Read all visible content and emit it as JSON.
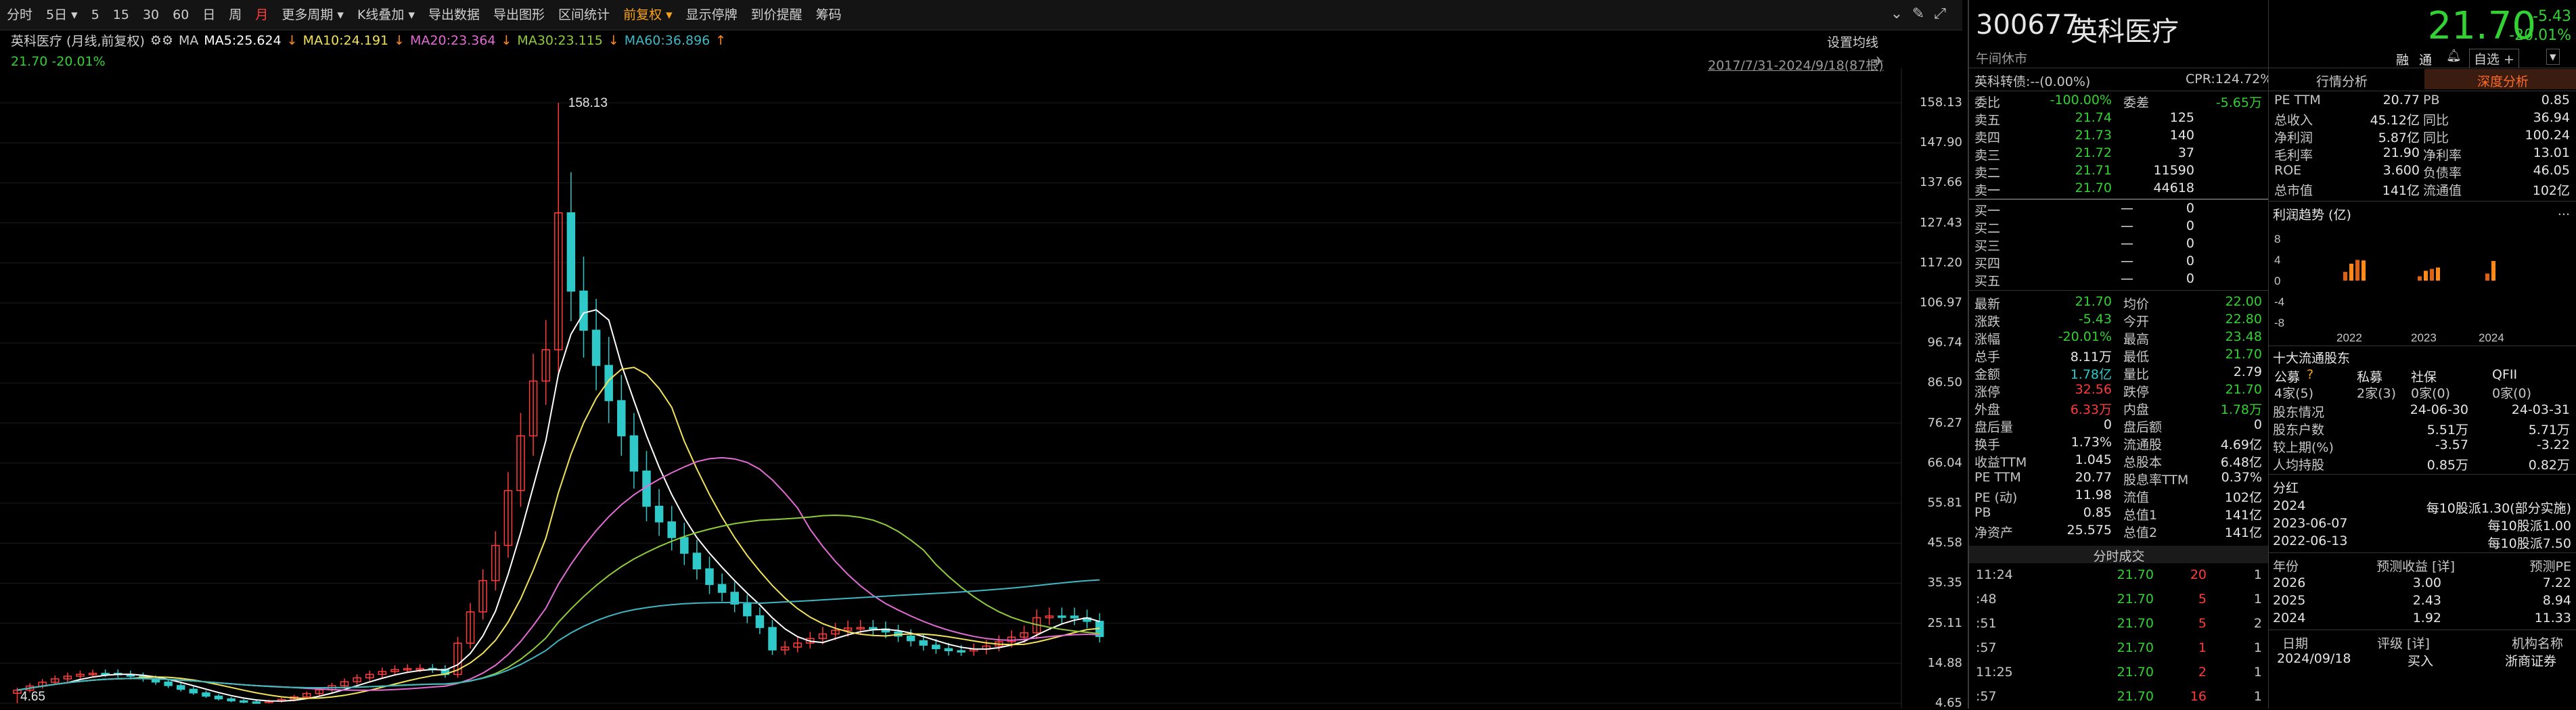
{
  "toolbar": {
    "items": [
      "分时",
      "5日",
      "5",
      "15",
      "30",
      "60",
      "日",
      "周",
      "月",
      "更多周期",
      "K线叠加",
      "导出数据",
      "导出图形",
      "区间统计",
      "前复权",
      "显示停牌",
      "到价提醒",
      "筹码"
    ],
    "active_index": 8
  },
  "chart": {
    "title": "英科医疗 (月线,前复权)",
    "ma_label": "MA",
    "ma5": "MA5:25.624",
    "ma10": "MA10:24.191",
    "ma20": "MA20:23.364",
    "ma30": "MA30:23.115",
    "ma60": "MA60:36.896",
    "ma_arrow_up": "↑",
    "ma_arrow_down": "↓",
    "price_line": "21.70  -20.01%",
    "settings": "设置均线",
    "range": "2017/7/31-2024/9/18(87根)",
    "peak_label": "158.13",
    "low_label": "4.65",
    "y_ticks": [
      "158.13",
      "147.90",
      "137.66",
      "127.43",
      "117.20",
      "106.97",
      "96.74",
      "86.50",
      "76.27",
      "66.04",
      "55.81",
      "45.58",
      "35.35",
      "25.11",
      "14.88",
      "4.65"
    ],
    "colors": {
      "ma5": "#ffffff",
      "ma10": "#f2e35a",
      "ma20": "#e36bd4",
      "ma30": "#8fcc3a",
      "ma60": "#3fb8c4",
      "up": "#ff3b3b",
      "down": "#2fc9c9"
    }
  },
  "quote": {
    "code": "300677",
    "name": "英科医疗",
    "status": "午间休市",
    "price": "21.70",
    "change": "-5.43",
    "change_pct": "-20.01%",
    "tags": [
      "融",
      "通"
    ],
    "watch": "自选 +",
    "convert": "英科转债:--(0.00%)",
    "cpr": "CPR:124.72%"
  },
  "orderbook": {
    "weibi_label": "委比",
    "weibi_value": "-100.00%",
    "weicha_label": "委差",
    "weicha_value": "-5.65万",
    "asks": [
      {
        "label": "卖五",
        "price": "21.74",
        "vol": "125"
      },
      {
        "label": "卖四",
        "price": "21.73",
        "vol": "140"
      },
      {
        "label": "卖三",
        "price": "21.72",
        "vol": "37"
      },
      {
        "label": "卖二",
        "price": "21.71",
        "vol": "11590"
      },
      {
        "label": "卖一",
        "price": "21.70",
        "vol": "44618"
      }
    ],
    "bids": [
      {
        "label": "买一",
        "price": "—",
        "vol": "0"
      },
      {
        "label": "买二",
        "price": "—",
        "vol": "0"
      },
      {
        "label": "买三",
        "price": "—",
        "vol": "0"
      },
      {
        "label": "买四",
        "price": "—",
        "vol": "0"
      },
      {
        "label": "买五",
        "price": "—",
        "vol": "0"
      }
    ]
  },
  "stats": [
    {
      "l1": "最新",
      "v1": "21.70",
      "c1": "green",
      "l2": "均价",
      "v2": "22.00",
      "c2": "green"
    },
    {
      "l1": "涨跌",
      "v1": "-5.43",
      "c1": "green",
      "l2": "今开",
      "v2": "22.80",
      "c2": "green"
    },
    {
      "l1": "涨幅",
      "v1": "-20.01%",
      "c1": "green",
      "l2": "最高",
      "v2": "23.48",
      "c2": "green"
    },
    {
      "l1": "总手",
      "v1": "8.11万",
      "c1": "white",
      "l2": "最低",
      "v2": "21.70",
      "c2": "green"
    },
    {
      "l1": "金额",
      "v1": "1.78亿",
      "c1": "cyan",
      "l2": "量比",
      "v2": "2.79",
      "c2": "white"
    },
    {
      "l1": "涨停",
      "v1": "32.56",
      "c1": "red",
      "l2": "跌停",
      "v2": "21.70",
      "c2": "green"
    },
    {
      "l1": "外盘",
      "v1": "6.33万",
      "c1": "red",
      "l2": "内盘",
      "v2": "1.78万",
      "c2": "green"
    },
    {
      "l1": "盘后量",
      "v1": "0",
      "c1": "white",
      "l2": "盘后额",
      "v2": "0",
      "c2": "white"
    },
    {
      "l1": "换手",
      "v1": "1.73%",
      "c1": "white",
      "l2": "流通股",
      "v2": "4.69亿",
      "c2": "white"
    },
    {
      "l1": "收益TTM",
      "v1": "1.045",
      "c1": "white",
      "l2": "总股本",
      "v2": "6.48亿",
      "c2": "white"
    },
    {
      "l1": "PE TTM",
      "v1": "20.77",
      "c1": "white",
      "l2": "股息率TTM",
      "v2": "0.37%",
      "c2": "white"
    },
    {
      "l1": "PE (动)",
      "v1": "11.98",
      "c1": "white",
      "l2": "流值",
      "v2": "102亿",
      "c2": "white"
    },
    {
      "l1": "PB",
      "v1": "0.85",
      "c1": "white",
      "l2": "总值1",
      "v2": "141亿",
      "c2": "white"
    },
    {
      "l1": "净资产",
      "v1": "25.575",
      "c1": "white",
      "l2": "总值2",
      "v2": "141亿",
      "c2": "white"
    }
  ],
  "ticks_title": "分时成交",
  "ticks": [
    {
      "t": "11:24",
      "p": "21.70",
      "v": "20",
      "n": "1"
    },
    {
      "t": ":48",
      "p": "21.70",
      "v": "5",
      "n": "1"
    },
    {
      "t": ":51",
      "p": "21.70",
      "v": "5",
      "n": "2"
    },
    {
      "t": ":57",
      "p": "21.70",
      "v": "1",
      "n": "1"
    },
    {
      "t": "11:25",
      "p": "21.70",
      "v": "2",
      "n": "1"
    },
    {
      "t": ":57",
      "p": "21.70",
      "v": "16",
      "n": "1"
    }
  ],
  "fundamentals": {
    "tab1": "行情分析",
    "tab2": "深度分析",
    "rows": [
      {
        "l1": "PE TTM",
        "v1": "20.77",
        "l2": "PB",
        "v2": "0.85"
      },
      {
        "l1": "总收入",
        "v1": "45.12亿",
        "l2": "同比",
        "v2": "36.94"
      },
      {
        "l1": "净利润",
        "v1": "5.87亿",
        "l2": "同比",
        "v2": "100.24"
      },
      {
        "l1": "毛利率",
        "v1": "21.90",
        "l2": "净利率",
        "v2": "13.01"
      },
      {
        "l1": "ROE",
        "v1": "3.600",
        "l2": "负债率",
        "v2": "46.05"
      },
      {
        "l1": "总市值",
        "v1": "141亿",
        "l2": "流通值",
        "v2": "102亿"
      }
    ],
    "profit_title": "利润趋势 (亿)",
    "profit_y": [
      "8",
      "4",
      "0",
      "-4",
      "-8"
    ],
    "profit_years": [
      "2022",
      "2023",
      "2024"
    ],
    "profit_bars": [
      [
        3.2,
        6.2,
        7.6,
        7.4
      ],
      [
        1.6,
        3.6,
        4.3,
        4.8
      ],
      [
        2.6,
        7.2
      ]
    ],
    "holders_title": "十大流通股东",
    "holders_cols": [
      "公募",
      "私募",
      "社保",
      "QFII"
    ],
    "holders_vals": [
      "4家(5)",
      "2家(3)",
      "0家(0)",
      "0家(0)"
    ],
    "holders_rows": [
      {
        "l": "股东情况",
        "v1": "24-06-30",
        "v2": "24-03-31"
      },
      {
        "l": "股东户数",
        "v1": "5.51万",
        "v2": "5.71万"
      },
      {
        "l": "较上期(%)",
        "v1": "-3.57",
        "v2": "-3.22"
      },
      {
        "l": "人均持股",
        "v1": "0.85万",
        "v2": "0.82万"
      }
    ],
    "dividend_title": "分红",
    "dividends": [
      {
        "d": "2024",
        "v": "每10股派1.30(部分实施)"
      },
      {
        "d": "2023-06-07",
        "v": "每10股派1.00"
      },
      {
        "d": "2022-06-13",
        "v": "每10股派7.50"
      }
    ],
    "forecast_cols": [
      "年份",
      "预测收益 [详]",
      "预测PE"
    ],
    "forecast": [
      {
        "y": "2026",
        "e": "3.00",
        "pe": "7.22"
      },
      {
        "y": "2025",
        "e": "2.43",
        "pe": "8.94"
      },
      {
        "y": "2024",
        "e": "1.92",
        "pe": "11.33"
      }
    ],
    "rating_cols": [
      "日期",
      "评级 [详]",
      "机构名称"
    ],
    "rating": {
      "d": "2024/09/18",
      "r": "买入",
      "o": "浙商证券"
    }
  }
}
